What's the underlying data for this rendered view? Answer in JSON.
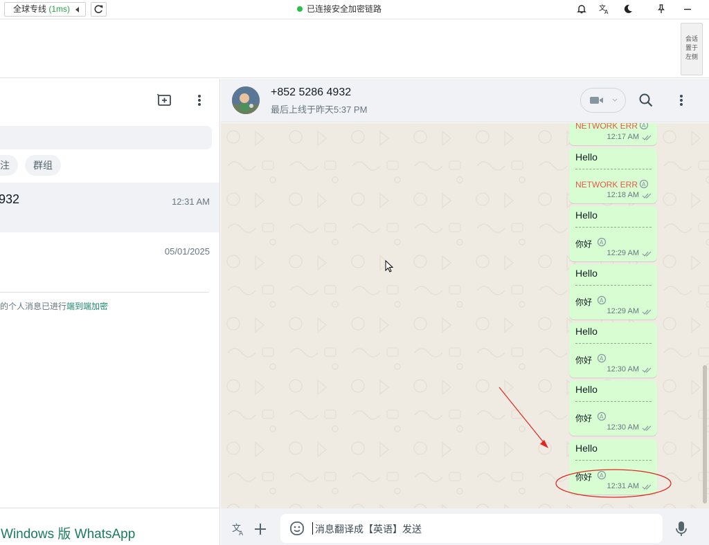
{
  "topbar": {
    "line_label": "全球专线",
    "latency": "(1ms)",
    "status_text": "已连接安全加密链路"
  },
  "strip": {
    "pin_left_label_1": "会话",
    "pin_left_label_2": "置于",
    "pin_left_label_3": "左侧"
  },
  "left_panel": {
    "chips": [
      "注",
      "群组"
    ],
    "chats": [
      {
        "name": "932",
        "time": "12:31 AM"
      },
      {
        "name": "",
        "time": "05/01/2025"
      }
    ],
    "e2e_prefix": "的个人消息已进行",
    "e2e_link": "端到端加密",
    "brand": "Windows 版 WhatsApp"
  },
  "chat_header": {
    "name": "+852 5286 4932",
    "last_seen": "最后上线于昨天5:37 PM"
  },
  "messages": [
    {
      "error": "NETWORK ERR",
      "time": "12:17 AM"
    },
    {
      "text": "Hello",
      "error": "NETWORK ERR",
      "time": "12:18 AM"
    },
    {
      "text": "Hello",
      "translation": "你好",
      "time": "12:29 AM"
    },
    {
      "text": "Hello",
      "translation": "你好",
      "time": "12:29 AM"
    },
    {
      "text": "Hello",
      "translation": "你好",
      "time": "12:30 AM"
    },
    {
      "text": "Hello",
      "translation": "你好",
      "time": "12:30 AM"
    },
    {
      "text": "Hello",
      "translation": "你好",
      "time": "12:31 AM"
    }
  ],
  "footer": {
    "input_placeholder": "消息翻译成【英语】发送"
  },
  "colors": {
    "bubble": "#d9fdd3",
    "chat_bg": "#efeae2",
    "error": "#e05a46",
    "annotation": "#e0261f",
    "brand_green": "#1b7a5f"
  }
}
